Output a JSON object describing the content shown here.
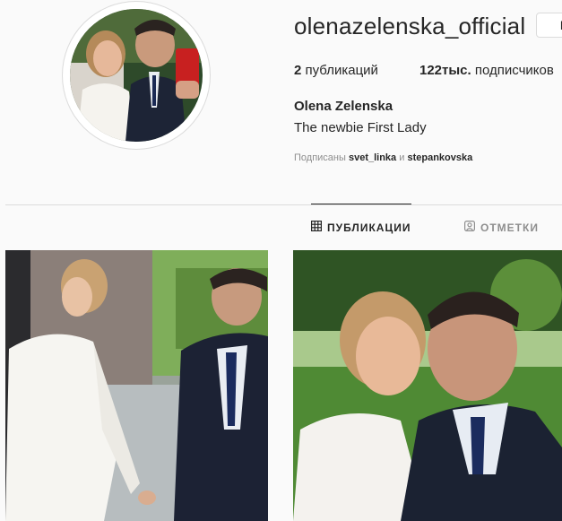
{
  "profile": {
    "username": "olenazelenska_official",
    "follow_label": "Подписаться",
    "stats": {
      "posts_count": "2",
      "posts_label": "публикаций",
      "followers_count": "122тыс.",
      "followers_label": "подписчиков"
    },
    "full_name": "Olena Zelenska",
    "bio": "The newbie First Lady",
    "followed_by": {
      "prefix": "Подписаны",
      "user1": "svet_linka",
      "conjunction": "и",
      "user2": "stepankovska"
    }
  },
  "tabs": [
    {
      "label": "ПУБЛИКАЦИИ",
      "icon": "grid-icon",
      "active": true
    },
    {
      "label": "ОТМЕТКИ",
      "icon": "tagged-icon",
      "active": false
    }
  ],
  "posts": [
    {
      "type": "photo",
      "icon": "photo-couple-street"
    },
    {
      "type": "photo",
      "icon": "photo-couple-selfie"
    }
  ],
  "colors": {
    "text": "#262626",
    "muted": "#8e8e8e",
    "border": "#dbdbdb",
    "background": "#fafafa"
  }
}
